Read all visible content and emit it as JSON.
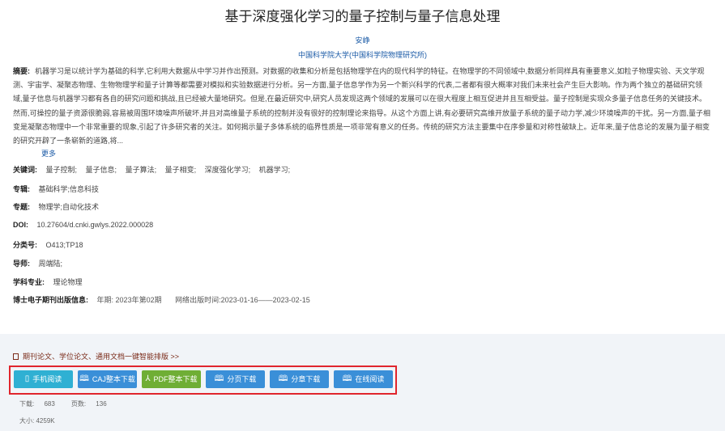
{
  "title": "基于深度强化学习的量子控制与量子信息处理",
  "author": "安峥",
  "organization": "中国科学院大学(中国科学院物理研究所)",
  "abstract": {
    "label": "摘要:",
    "text": "机器学习是以统计学为基础的科学,它利用大数据从中学习并作出预测。对数据的收集和分析是包括物理学在内的现代科学的特征。在物理学的不同领域中,数据分析同样具有重要意义,如粒子物理实验、天文学观测、宇宙学、凝聚态物理、生物物理学和量子计算等都需要对模拟和实验数据进行分析。另一方面,量子信息学作为另一个新兴科学的代表,二者都有很大概率对我们未来社会产生巨大影响。作为两个独立的基础研究领域,量子信息与机器学习都有各自的研究问题和挑战,且已经被大量地研究。但是,在最近研究中,研究人员发现这两个领域的发展可以在很大程度上相互促进并且互相受益。量子控制是实现众多量子信息任务的关键技术。然而,可操控的量子资源很脆弱,容易被周围环境噪声所破坏,并且对高维量子系统的控制并没有很好的控制理论来指导。从这个方面上讲,有必要研究高维开放量子系统的量子动力学,减少环境噪声的干扰。另一方面,量子相变是凝聚态物理中一个非常重要的现象,引起了许多研究者的关注。如何揭示量子多体系统的临界性质是一项非常有意义的任务。传统的研究方法主要集中在序参量和对称性破缺上。近年来,量子信息论的发展为量子相变的研究开辟了一条崭新的道路,将...",
    "more": "更多"
  },
  "keywords": {
    "label": "关键词:",
    "items": [
      "量子控制;",
      "量子信息;",
      "量子算法;",
      "量子相变;",
      "深度强化学习;",
      "机器学习;"
    ]
  },
  "series": {
    "label": "专辑:",
    "value": "基础科学;信息科技"
  },
  "topic": {
    "label": "专题:",
    "value": "物理学;自动化技术"
  },
  "doi": {
    "label": "DOI:",
    "value": "10.27604/d.cnki.gwlys.2022.000028"
  },
  "classification": {
    "label": "分类号:",
    "value": "O413;TP18"
  },
  "supervisor": {
    "label": "导师:",
    "value": "周端陆;"
  },
  "major": {
    "label": "学科专业:",
    "value": "理论物理"
  },
  "publication": {
    "label": "博士电子期刊出版信息:",
    "year_label": "年期:",
    "year_value": "2023年第02期",
    "date_label": "网络出版时间:",
    "date_value": "2023-01-16——2023-02-15"
  },
  "promo": "期刊论文、学位论文、通用文档一键智能排版 >>",
  "buttons": {
    "mobile": "手机阅读",
    "caj": "CAJ整本下载",
    "pdf": "PDF整本下载",
    "page": "分页下载",
    "chapter": "分章下载",
    "online": "在线阅读"
  },
  "stats": {
    "downloads_label": "下载:",
    "downloads": "683",
    "pages_label": "页数:",
    "pages": "136",
    "size_label": "大小:",
    "size": "4259K"
  },
  "colors": {
    "highlight_border": "#e0252d",
    "button_blue": "#3a8fd8",
    "button_green": "#6fae35",
    "link": "#1a5aa6"
  }
}
